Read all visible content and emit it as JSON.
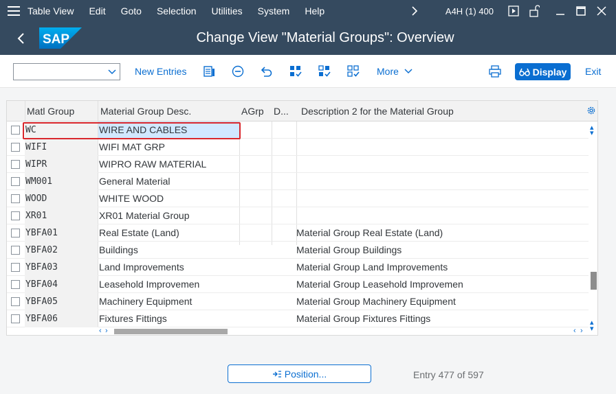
{
  "menubar": {
    "items": [
      "Table View",
      "Edit",
      "Goto",
      "Selection",
      "Utilities",
      "System",
      "Help"
    ],
    "system_info": "A4H (1) 400"
  },
  "titlebar": {
    "title": "Change View \"Material Groups\": Overview",
    "logo_text": "SAP"
  },
  "toolbar": {
    "command_field_value": "",
    "new_entries_label": "New Entries",
    "more_label": "More",
    "display_label": "Display",
    "exit_label": "Exit"
  },
  "table": {
    "columns": [
      "Matl Group",
      "Material Group Desc.",
      "AGrp",
      "D...",
      "Description 2 for the Material Group"
    ],
    "rows": [
      {
        "matl_group": "WC",
        "desc": "WIRE AND CABLES",
        "agrp": "",
        "d": "",
        "desc2": ""
      },
      {
        "matl_group": "WIFI",
        "desc": "WIFI MAT GRP",
        "agrp": "",
        "d": "",
        "desc2": ""
      },
      {
        "matl_group": "WIPR",
        "desc": "WIPRO RAW MATERIAL",
        "agrp": "",
        "d": "",
        "desc2": ""
      },
      {
        "matl_group": "WM001",
        "desc": "General Material",
        "agrp": "",
        "d": "",
        "desc2": ""
      },
      {
        "matl_group": "WOOD",
        "desc": "WHITE WOOD",
        "agrp": "",
        "d": "",
        "desc2": ""
      },
      {
        "matl_group": "XR01",
        "desc": "XR01 Material Group",
        "agrp": "",
        "d": "",
        "desc2": ""
      },
      {
        "matl_group": "YBFA01",
        "desc": "Real Estate (Land)",
        "agrp": "",
        "d": "",
        "desc2": "Material Group Real Estate (Land)"
      },
      {
        "matl_group": "YBFA02",
        "desc": "Buildings",
        "agrp": "",
        "d": "",
        "desc2": "Material Group Buildings"
      },
      {
        "matl_group": "YBFA03",
        "desc": "Land Improvements",
        "agrp": "",
        "d": "",
        "desc2": "Material Group Land Improvements"
      },
      {
        "matl_group": "YBFA04",
        "desc": "Leasehold Improvemen",
        "agrp": "",
        "d": "",
        "desc2": "Material Group Leasehold Improvemen"
      },
      {
        "matl_group": "YBFA05",
        "desc": "Machinery Equipment",
        "agrp": "",
        "d": "",
        "desc2": "Material Group Machinery Equipment"
      },
      {
        "matl_group": "YBFA06",
        "desc": "Fixtures Fittings",
        "agrp": "",
        "d": "",
        "desc2": "Material Group Fixtures Fittings"
      }
    ]
  },
  "footer": {
    "position_label": "Position...",
    "entry_info": "Entry 477 of 597"
  },
  "colors": {
    "shell": "#354a5f",
    "accent": "#0a6ed1",
    "highlight_border": "#d9262b",
    "selected_cell": "#d1e8ff"
  }
}
